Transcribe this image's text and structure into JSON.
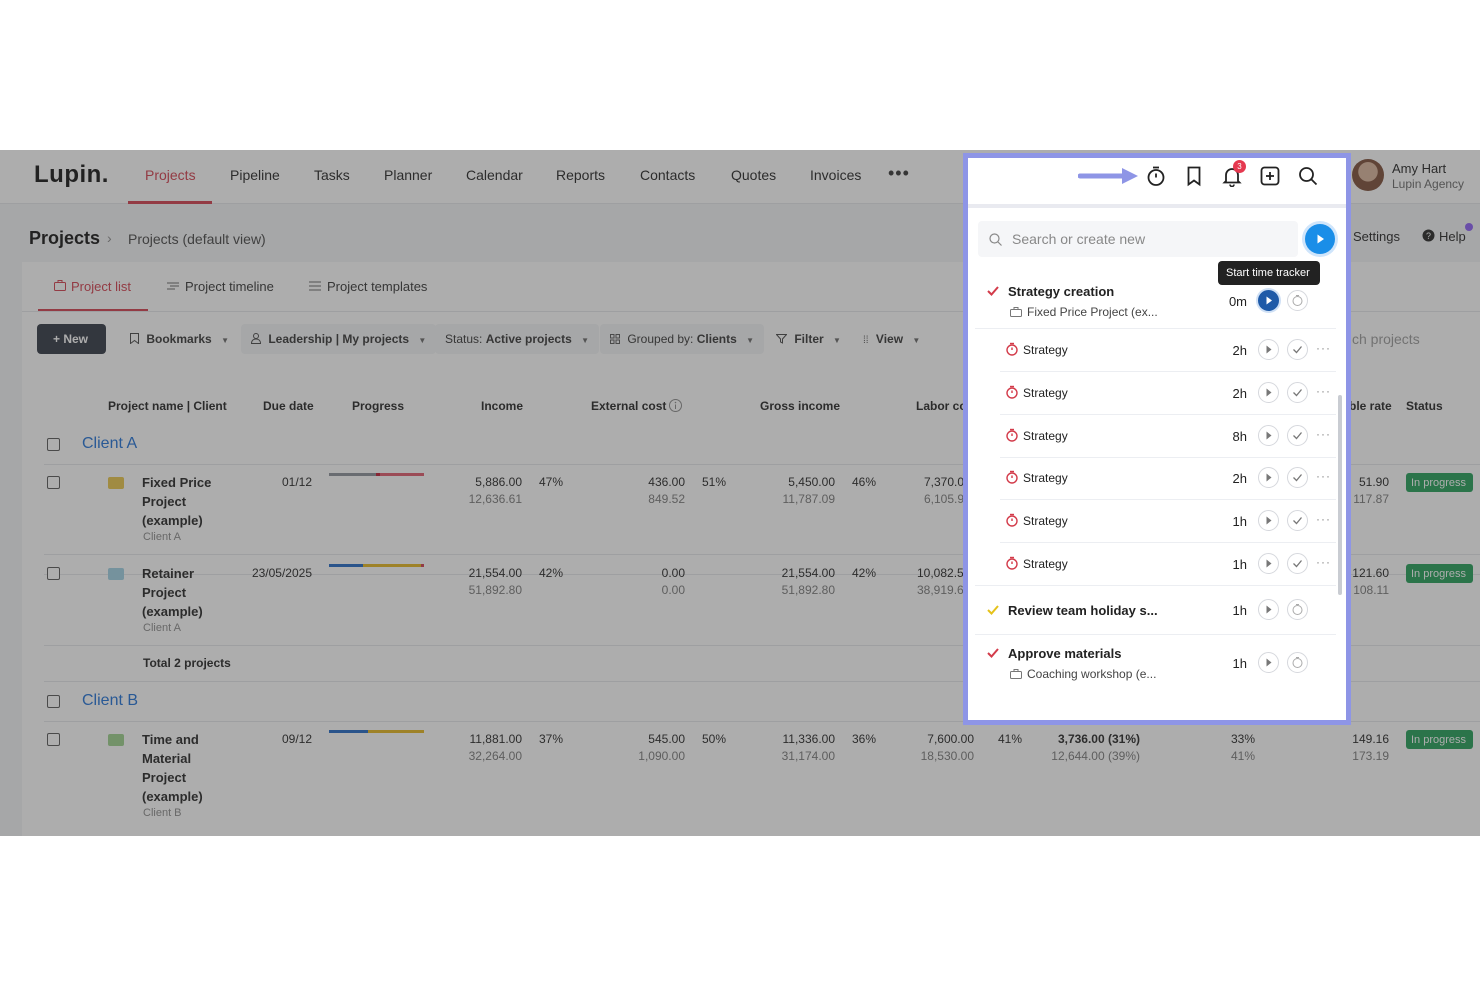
{
  "nav": {
    "logo": "Lupin.",
    "items": [
      "Projects",
      "Pipeline",
      "Tasks",
      "Planner",
      "Calendar",
      "Reports",
      "Contacts",
      "Quotes",
      "Invoices"
    ],
    "more": "•••",
    "user_name": "Amy Hart",
    "user_org": "Lupin Agency"
  },
  "header": {
    "title": "Projects",
    "breadcrumb_sep": "›",
    "breadcrumb": "Projects (default view)",
    "settings": "Settings",
    "help": "Help"
  },
  "subtabs": [
    "Project list",
    "Project timeline",
    "Project templates"
  ],
  "toolbar": {
    "new": "+ New",
    "bookmarks": "Bookmarks",
    "leadership": "Leadership | My projects",
    "status_label": "Status:",
    "status_value": "Active projects",
    "grouped_label": "Grouped by:",
    "grouped_value": "Clients",
    "filter": "Filter",
    "view": "View",
    "search_tail": "ch projects"
  },
  "table": {
    "headers": {
      "name": "Project name | Client",
      "due": "Due date",
      "progress": "Progress",
      "income": "Income",
      "external": "External cost",
      "gross": "Gross income",
      "labor": "Labor co",
      "rate": "ble rate",
      "status": "Status"
    },
    "groups": [
      {
        "name": "Client A",
        "rows": [
          {
            "name": "Fixed Price Project (example)",
            "client": "Client A",
            "due": "01/12",
            "income": "5,886.00",
            "income2": "12,636.61",
            "income_pct": "47%",
            "ext": "436.00",
            "ext2": "849.52",
            "ext_pct": "51%",
            "gross": "5,450.00",
            "gross2": "11,787.09",
            "gross_pct": "46%",
            "labor": "7,370.0",
            "labor2": "6,105.9",
            "rate": "51.90",
            "rate2": "117.87",
            "status": "In progress"
          },
          {
            "name": "Retainer Project (example)",
            "client": "Client A",
            "due": "23/05/2025",
            "income": "21,554.00",
            "income2": "51,892.80",
            "income_pct": "42%",
            "ext": "0.00",
            "ext2": "0.00",
            "ext_pct": "",
            "gross": "21,554.00",
            "gross2": "51,892.80",
            "gross_pct": "42%",
            "labor": "10,082.5",
            "labor2": "38,919.6",
            "rate": "121.60",
            "rate2": "108.11",
            "status": "In progress"
          }
        ],
        "total": "Total 2 projects"
      },
      {
        "name": "Client B",
        "rows": [
          {
            "name": "Time and Material Project (example)",
            "client": "Client B",
            "due": "09/12",
            "income": "11,881.00",
            "income2": "32,264.00",
            "income_pct": "37%",
            "ext": "545.00",
            "ext2": "1,090.00",
            "ext_pct": "50%",
            "gross": "11,336.00",
            "gross2": "31,174.00",
            "gross_pct": "36%",
            "labor": "7,600.00",
            "labor2": "18,530.00",
            "labor_pct": "41%",
            "margin": "3,736.00 (31%)",
            "margin2": "12,644.00 (39%)",
            "util": "33%",
            "util2": "41%",
            "rate": "149.16",
            "rate2": "173.19",
            "status": "In progress"
          }
        ]
      }
    ]
  },
  "tracker": {
    "search_placeholder": "Search or create new",
    "tooltip": "Start time tracker",
    "notif_count": "3",
    "entries": [
      {
        "title": "Strategy creation",
        "sub": "Fixed Price Project (ex...",
        "duration": "0m"
      },
      {
        "title": "Strategy",
        "duration": "2h"
      },
      {
        "title": "Strategy",
        "duration": "2h"
      },
      {
        "title": "Strategy",
        "duration": "8h"
      },
      {
        "title": "Strategy",
        "duration": "2h"
      },
      {
        "title": "Strategy",
        "duration": "1h"
      },
      {
        "title": "Strategy",
        "duration": "1h"
      },
      {
        "title": "Review team holiday s...",
        "duration": "1h"
      },
      {
        "title": "Approve materials",
        "sub": "Coaching workshop (e...",
        "duration": "1h"
      }
    ]
  },
  "colors": {
    "accent": "#d33b4a",
    "link": "#1d6fd6",
    "status_green": "#1f9d55",
    "panel_border": "#8e95e6",
    "play_blue": "#1a8ee8"
  }
}
